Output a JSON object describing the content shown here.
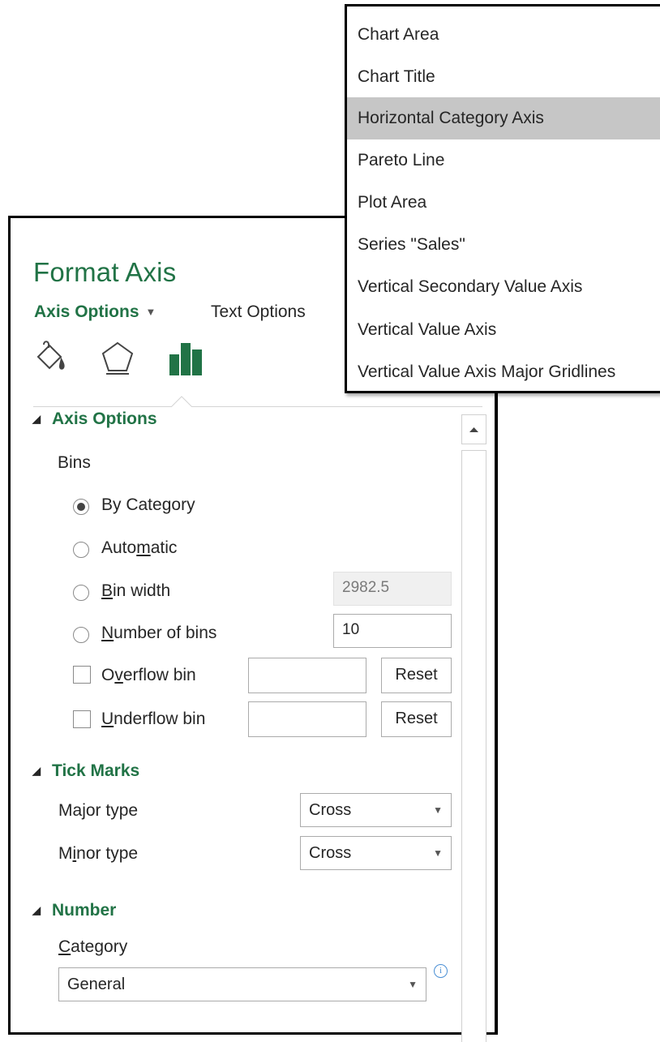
{
  "pane": {
    "title": "Format Axis",
    "tabs": {
      "active": "Axis Options",
      "other": "Text Options"
    },
    "icons": [
      "fill-line-icon",
      "effects-pentagon-icon",
      "axis-options-bar-chart-icon"
    ]
  },
  "axis_options": {
    "header": "Axis Options",
    "bins_label": "Bins",
    "radios": [
      {
        "pre": "By Cate",
        "ul": "g",
        "post": "ory",
        "selected": true
      },
      {
        "pre": "Auto",
        "ul": "m",
        "post": "atic",
        "selected": false
      },
      {
        "pre": "",
        "ul": "B",
        "post": "in width",
        "selected": false,
        "value": "2982.5",
        "disabled": true
      },
      {
        "pre": "",
        "ul": "N",
        "post": "umber of bins",
        "selected": false,
        "value": "10"
      }
    ],
    "checks": [
      {
        "pre": "O",
        "ul": "v",
        "post": "erflow bin",
        "checked": false,
        "value": "",
        "button": "Reset"
      },
      {
        "pre": "",
        "ul": "U",
        "post": "nderflow bin",
        "checked": false,
        "value": "",
        "button": "Reset"
      }
    ]
  },
  "tick_marks": {
    "header": "Tick Marks",
    "major": {
      "pre": "Ma",
      "ul": "j",
      "post": "or type",
      "value": "Cross"
    },
    "minor": {
      "pre": "M",
      "ul": "i",
      "post": "nor type",
      "value": "Cross"
    }
  },
  "number": {
    "header": "Number",
    "category": {
      "pre": "",
      "ul": "C",
      "post": "ategory",
      "value": "General"
    }
  },
  "element_menu": {
    "items": [
      "Chart Area",
      "Chart Title",
      "Horizontal Category Axis",
      "Pareto Line",
      "Plot Area",
      "Series \"Sales\"",
      "Vertical Secondary Value Axis",
      "Vertical Value Axis",
      "Vertical Value Axis Major Gridlines"
    ],
    "selected_index": 2
  },
  "colors": {
    "accent": "#217346",
    "selected_row": "#c6c6c6",
    "info": "#4a8fd4"
  }
}
